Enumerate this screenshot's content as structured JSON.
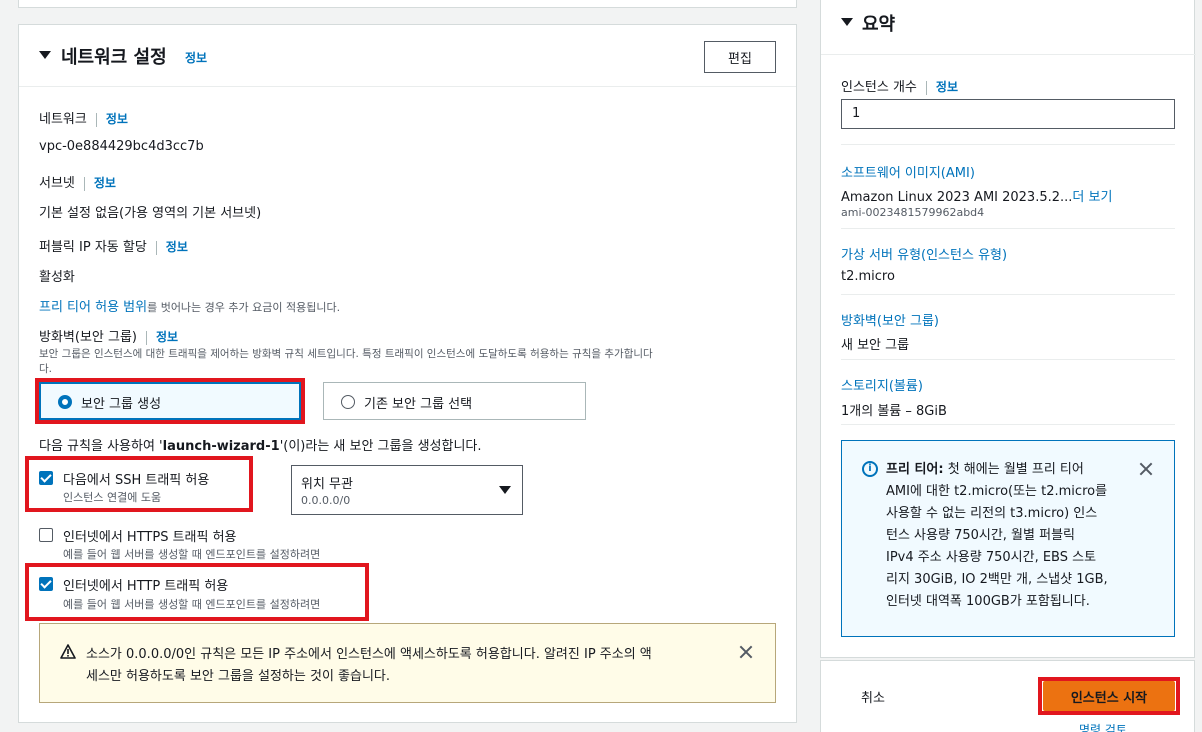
{
  "network_section": {
    "title": "네트워크 설정",
    "info": "정보",
    "edit_button": "편집",
    "network_label": "네트워크",
    "network_info": "정보",
    "network_value": "vpc-0e884429bc4d3cc7b",
    "subnet_label": "서브넷",
    "subnet_info": "정보",
    "subnet_value": "기본 설정 없음(가용 영역의 기본 서브넷)",
    "public_ip_label": "퍼블릭 IP 자동 할당",
    "public_ip_info": "정보",
    "public_ip_value": "활성화",
    "free_tier_link": "프리 티어 허용 범위",
    "free_tier_note": "를 벗어나는 경우 추가 요금이 적용됩니다.",
    "firewall_label": "방화벽(보안 그룹)",
    "firewall_info": "정보",
    "firewall_desc_line1": "보안 그룹은 인스턴스에 대한 트래픽을 제어하는 방화벽 규칙 세트입니다. 특정 트래픽이 인스턴스에 도달하도록 허용하는 규칙을 추가합니다",
    "firewall_desc_line2": "다.",
    "radio_create": "보안 그룹 생성",
    "radio_existing": "기존 보안 그룹 선택",
    "rule_note_prefix": "다음 규칙을 사용하여 '",
    "rule_note_name": "launch-wizard-1",
    "rule_note_suffix": "'(이)라는 새 보안 그룹을 생성합니다.",
    "ssh_label": "다음에서 SSH 트래픽 허용",
    "ssh_desc": "인스턴스 연결에 도움",
    "ssh_checked": true,
    "source_select_value": "위치 무관",
    "source_select_sub": "0.0.0.0/0",
    "https_label": "인터넷에서 HTTPS 트래픽 허용",
    "https_desc": "예를 들어 웹 서버를 생성할 때 엔드포인트를 설정하려면",
    "https_checked": false,
    "http_label": "인터넷에서 HTTP 트래픽 허용",
    "http_desc": "예를 들어 웹 서버를 생성할 때 엔드포인트를 설정하려면",
    "http_checked": true,
    "warning_line1": "소스가 0.0.0.0/0인 규칙은 모든 IP 주소에서 인스턴스에 액세스하도록 허용합니다. 알려진 IP 주소의 액",
    "warning_line2": "세스만 허용하도록 보안 그룹을 설정하는 것이 좋습니다."
  },
  "summary": {
    "title": "요약",
    "instance_count_label": "인스턴스 개수",
    "instance_count_info": "정보",
    "instance_count_value": "1",
    "ami_label": "소프트웨어 이미지(AMI)",
    "ami_value": "Amazon Linux 2023 AMI 2023.5.2...",
    "ami_more": "더 보기",
    "ami_id": "ami-0023481579962abd4",
    "instance_type_label": "가상 서버 유형(인스턴스 유형)",
    "instance_type_value": "t2.micro",
    "firewall_label": "방화벽(보안 그룹)",
    "firewall_value": "새 보안 그룹",
    "storage_label": "스토리지(볼륨)",
    "storage_value": "1개의 볼륨 – 8GiB",
    "free_tier_title": "프리 티어:",
    "free_tier_line1": "첫 해에는 월별 프리 티어",
    "free_tier_line2": "AMI에 대한 t2.micro(또는 t2.micro를",
    "free_tier_line3": "사용할 수 없는 리전의 t3.micro) 인스",
    "free_tier_line4": "턴스 사용량 750시간, 월별 퍼블릭",
    "free_tier_line5": "IPv4 주소 사용량 750시간, EBS 스토",
    "free_tier_line6": "리지 30GiB, IO 2백만 개, 스냅샷 1GB,",
    "free_tier_line7": "인터넷 대역폭 100GB가 포함됩니다."
  },
  "footer": {
    "cancel": "취소",
    "launch": "인스턴스 시작",
    "below_launch": "명령 검토"
  }
}
